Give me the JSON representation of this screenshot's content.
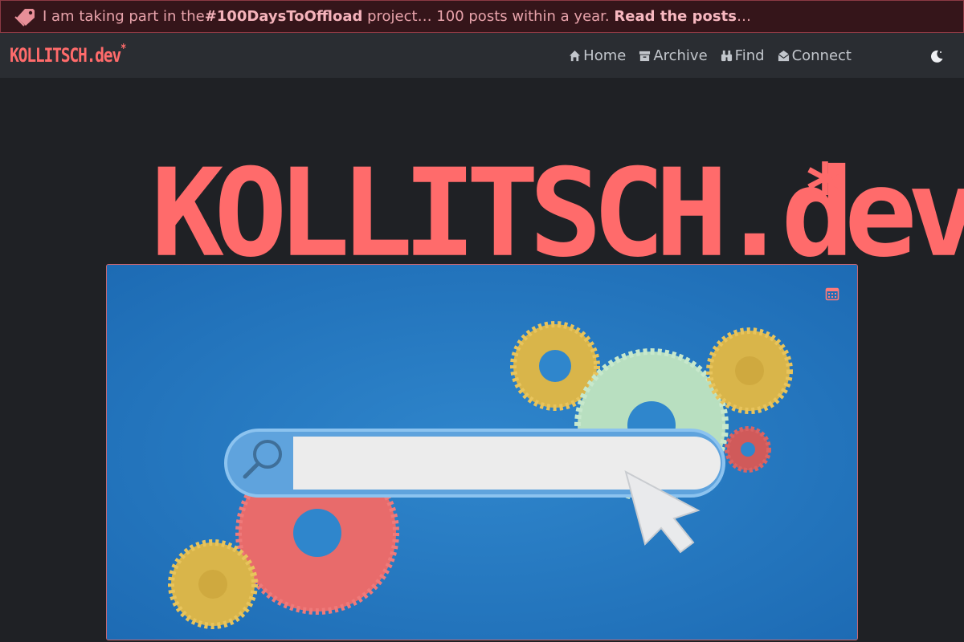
{
  "banner": {
    "prefix": "I am taking part in the ",
    "hashtag": "#100DaysToOffload",
    "middle": " project… 100 posts within a year. ",
    "link": "Read the posts",
    "suffix": "…",
    "icon": "tag-icon"
  },
  "brand": {
    "text": "KOLLITSCH.dev",
    "mark": "*"
  },
  "nav": {
    "items": [
      {
        "label": "Home",
        "icon": "home-icon"
      },
      {
        "label": "Archive",
        "icon": "archive-icon"
      },
      {
        "label": "Find",
        "icon": "binoculars-icon"
      },
      {
        "label": "Connect",
        "icon": "envelope-icon"
      }
    ],
    "theme_icon": "moon-icon"
  },
  "hero": {
    "title": "KOLLITSCH.dev",
    "mark": "*"
  },
  "card": {
    "date_icon": "calendar-icon"
  },
  "colors": {
    "accent": "#ff6b6b",
    "background": "#1f2125",
    "navbar": "#2a2d32",
    "banner": "#35151a"
  }
}
